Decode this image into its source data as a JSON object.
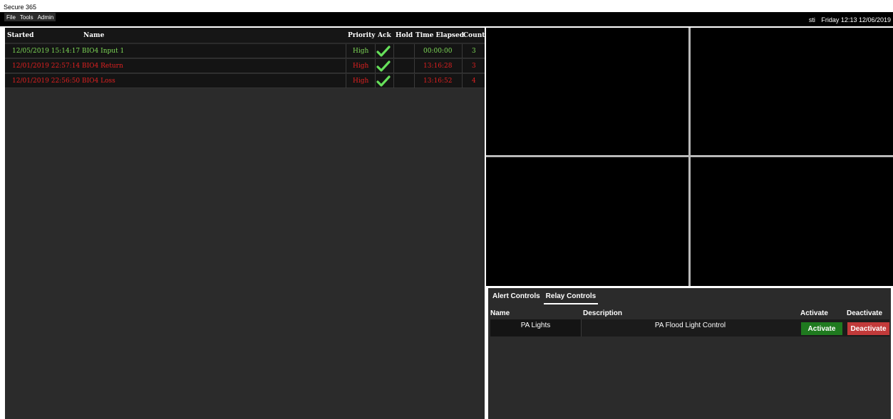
{
  "window": {
    "title": "Secure 365"
  },
  "menu": [
    {
      "label": "File"
    },
    {
      "label": "Tools"
    },
    {
      "label": "Admin"
    }
  ],
  "status": {
    "user": "sti",
    "datetime": "Friday 12:13 12/06/2019"
  },
  "alarms": {
    "columns": {
      "started": "Started",
      "name": "Name",
      "priority": "Priority",
      "ack": "Ack",
      "hold": "Hold",
      "elapsed": "Time Elapsed",
      "count": "Count"
    },
    "rows": [
      {
        "started": "12/05/2019 15:14:17",
        "name": "BIO4 Input 1",
        "priority": "High",
        "ack": true,
        "hold": "",
        "elapsed": "00:00:00",
        "count": "3",
        "color": "#7ed957"
      },
      {
        "started": "12/01/2019 22:57:14",
        "name": "BIO4 Return",
        "priority": "High",
        "ack": true,
        "hold": "",
        "elapsed": "13:16:28",
        "count": "3",
        "color": "#e02020"
      },
      {
        "started": "12/01/2019 22:56:50",
        "name": "BIO4 Loss",
        "priority": "High",
        "ack": true,
        "hold": "",
        "elapsed": "13:16:52",
        "count": "4",
        "color": "#e02020"
      }
    ]
  },
  "controls": {
    "tabs": [
      {
        "label": "Alert Controls",
        "active": false
      },
      {
        "label": "Relay Controls",
        "active": true
      }
    ],
    "columns": {
      "name": "Name",
      "description": "Description",
      "activate": "Activate",
      "deactivate": "Deactivate"
    },
    "relays": [
      {
        "name": "PA Lights",
        "description": "PA Flood Light Control",
        "activate_label": "Activate",
        "deactivate_label": "Deactivate"
      }
    ]
  },
  "colors": {
    "ok": "#7ed957",
    "alarm": "#e02020",
    "check": "#66e05a",
    "activate": "#1f7a1f",
    "deactivate": "#c23a3a"
  }
}
